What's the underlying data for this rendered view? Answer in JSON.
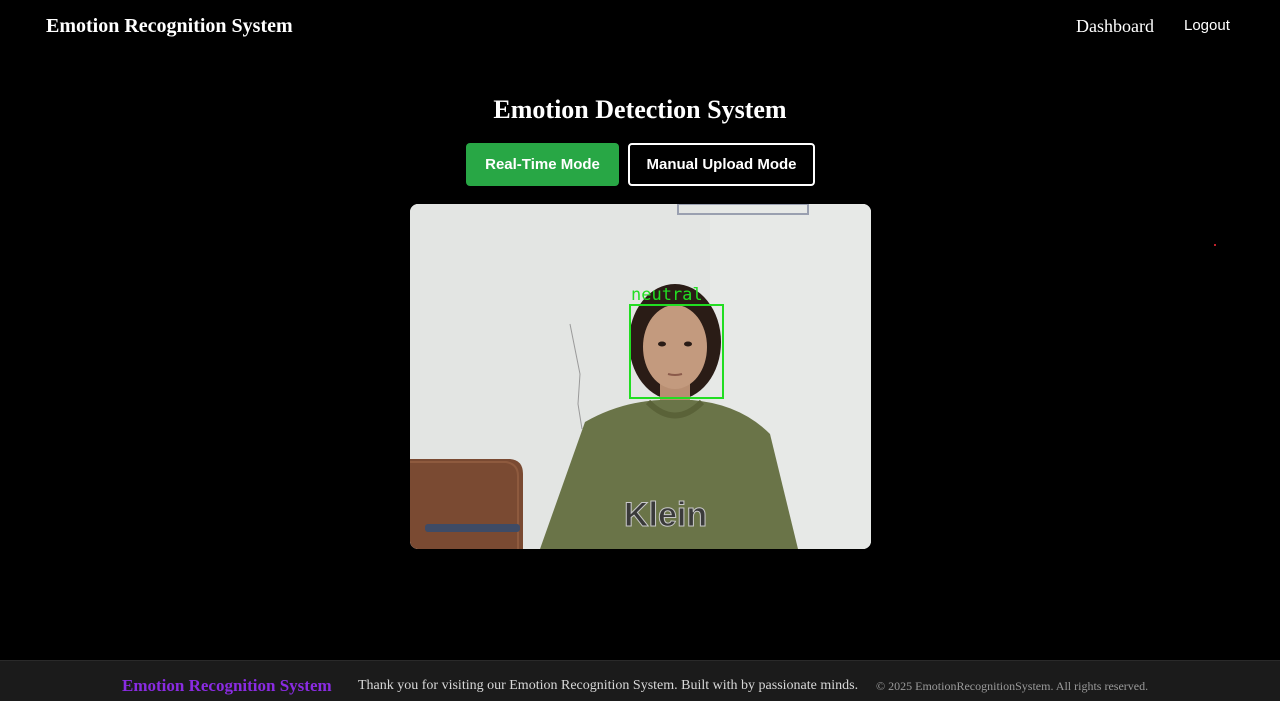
{
  "header": {
    "brand": "Emotion Recognition System",
    "nav": {
      "dashboard": "Dashboard",
      "logout": "Logout"
    }
  },
  "main": {
    "title": "Emotion Detection System",
    "modes": {
      "realtime_label": "Real-Time Mode",
      "upload_label": "Manual Upload Mode",
      "active": "Real-Time Mode"
    },
    "detection": {
      "label": "neutral",
      "box_color": "#22dd22"
    },
    "shirt_text": "Klein"
  },
  "footer": {
    "brand": "Emotion Recognition System",
    "message": "Thank you for visiting our Emotion Recognition System. Built with by passionate minds.",
    "copyright": "© 2025 EmotionRecognitionSystem. All rights reserved."
  },
  "colors": {
    "background": "#000000",
    "accent_green": "#28a745",
    "footer_brand": "#8a2be2",
    "footer_bg": "#1b1b1b"
  }
}
